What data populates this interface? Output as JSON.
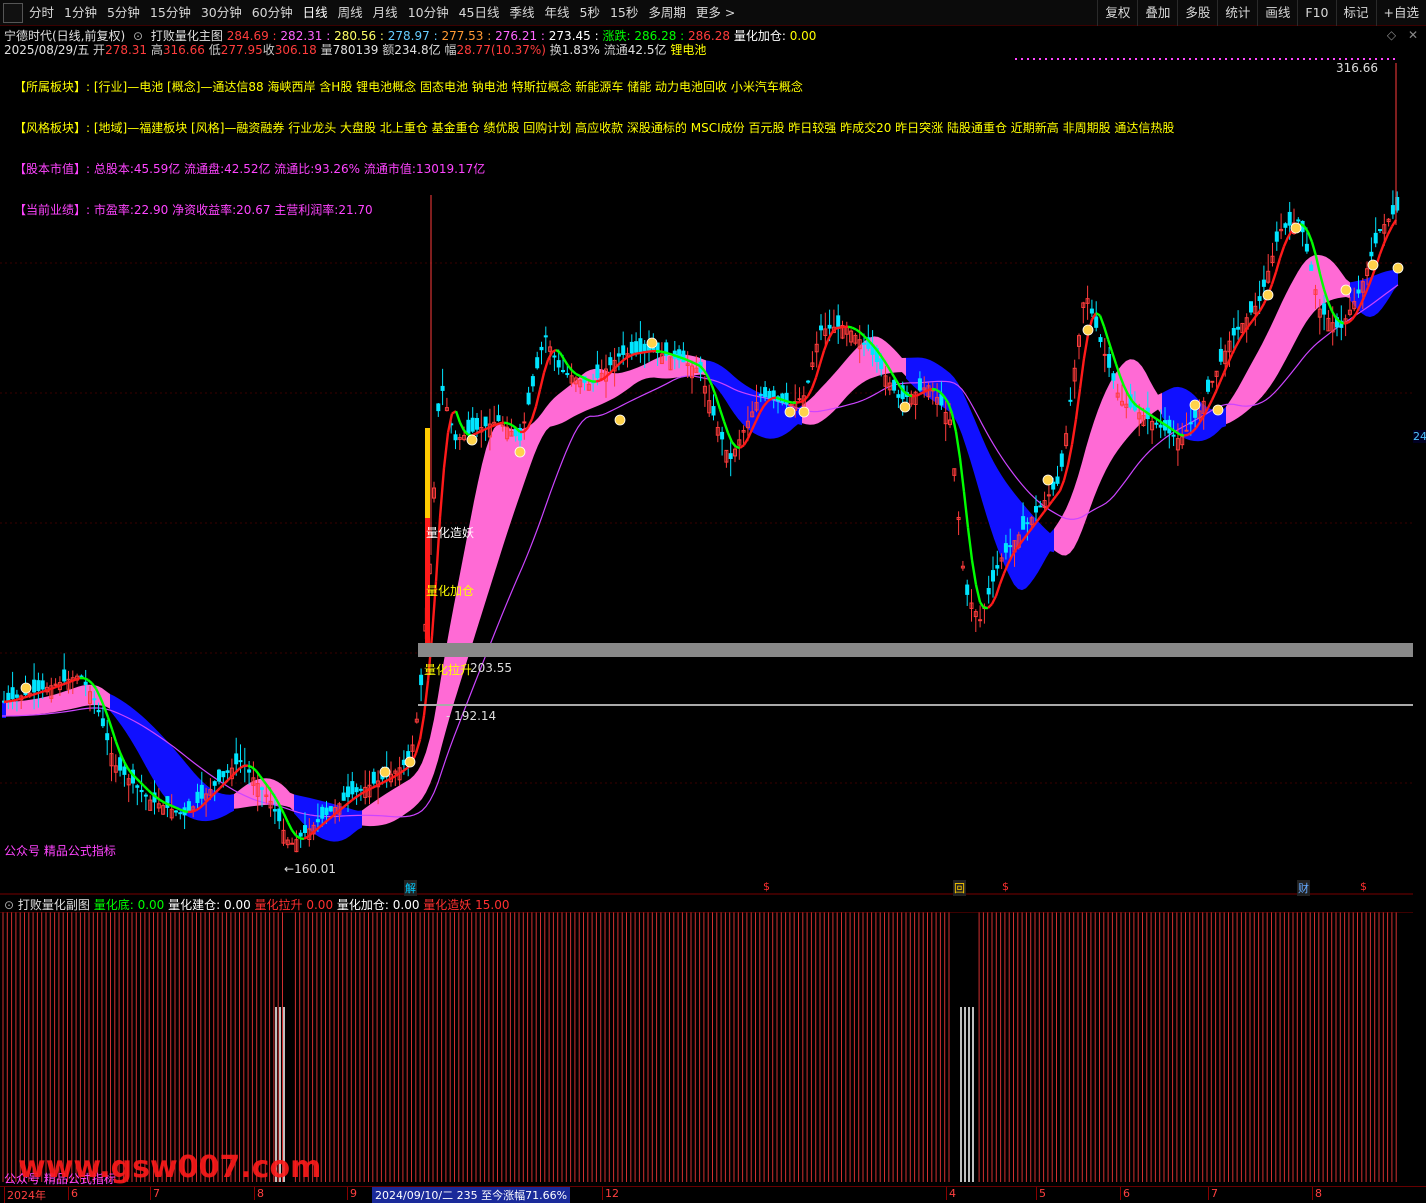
{
  "toolbar": {
    "periods": [
      "分时",
      "1分钟",
      "5分钟",
      "15分钟",
      "30分钟",
      "60分钟",
      "日线",
      "周线",
      "月线",
      "10分钟",
      "45日线",
      "季线",
      "年线",
      "5秒",
      "15秒",
      "多周期",
      "更多 >"
    ],
    "active_period": "日线",
    "right": [
      "复权",
      "叠加",
      "多股",
      "统计",
      "画线",
      "F10",
      "标记",
      "+自选"
    ]
  },
  "main": {
    "stock": "宁德时代(日线,前复权)",
    "indicator_name": "打败量化主图",
    "indicator_values": [
      "284.69",
      "282.31",
      "280.56",
      "278.97",
      "277.53",
      "276.21",
      "273.45"
    ],
    "rise_label": "涨跌:",
    "rise_values": [
      "286.28",
      "286.28"
    ],
    "add_label": "量化加仓:",
    "add_value": "0.00",
    "quote": {
      "date": "2025/08/29/五",
      "open_l": "开",
      "open": "278.31",
      "high_l": "高",
      "high": "316.66",
      "low_l": "低",
      "low": "277.95",
      "close_l": "收",
      "close": "306.18",
      "vol_l": "量",
      "vol": "780139",
      "amt_l": "额",
      "amt": "234.8亿",
      "chg_l": "幅",
      "chg": "28.77(10.37%)",
      "turn_l": "换",
      "turn": "1.83%",
      "float_l": "流通",
      "float": "42.5亿",
      "sector": "锂电池"
    },
    "info": [
      {
        "label": "【所属板块】:",
        "text": "[行业]—电池 [概念]—通达信88 海峡西岸 含H股 锂电池概念 固态电池 钠电池 特斯拉概念 新能源车 储能 动力电池回收 小米汽车概念",
        "color": "#ffff00",
        "text_color": "#ffff00"
      },
      {
        "label": "【风格板块】:",
        "text": "[地域]—福建板块 [风格]—融资融券 行业龙头 大盘股 北上重仓 基金重仓 绩优股 回购计划 高应收款 深股通标的 MSCI成份 百元股 昨日较强 昨成交20 昨日突涨 陆股通重仓 近期新高 非周期股 通达信热股",
        "color": "#ffff00",
        "text_color": "#ffff00"
      },
      {
        "label": "【股本市值】:",
        "text": "总股本:45.59亿 流通盘:42.52亿 流通比:93.26% 流通市值:13019.17亿",
        "color": "#ff44ff",
        "text_color": "#ff44ff"
      },
      {
        "label": "【当前业绩】:",
        "text": "市盈率:22.90 净资收益率:20.67 主营利润率:21.70",
        "color": "#ff44ff",
        "text_color": "#ff44ff"
      }
    ],
    "labels": {
      "max": "316.66",
      "min": "160.01",
      "level1": "203.55",
      "level2": "192.14",
      "level2_prefix": "-",
      "signal_zao": "量化造妖",
      "signal_jia": "量化加仓",
      "signal_la": "量化拉升",
      "watermark": "公众号 精品公式指标",
      "right_edge": "24"
    },
    "markers": [
      {
        "text": "解",
        "color": "#00ccff"
      },
      {
        "text": "$",
        "color": "#ff3030"
      },
      {
        "text": "回",
        "color": "#ffcc00"
      },
      {
        "text": "$",
        "color": "#ff3030"
      },
      {
        "text": "财",
        "color": "#66aaff"
      },
      {
        "text": "$",
        "color": "#ff3030"
      }
    ]
  },
  "sub": {
    "name": "打败量化副图",
    "items": [
      {
        "label": "量化底:",
        "value": "0.00",
        "color": "#00ff00"
      },
      {
        "label": "量化建仓:",
        "value": "0.00",
        "color": "#ffffff"
      },
      {
        "label": "量化拉升",
        "value": "0.00",
        "color": "#ff3030"
      },
      {
        "label": "量化加仓:",
        "value": "0.00",
        "color": "#ffffff"
      },
      {
        "label": "量化造妖",
        "value": "15.00",
        "color": "#ff3030"
      }
    ],
    "watermark": "公众号 精品公式指标",
    "site": "www.gsw007.com"
  },
  "axis": {
    "months": [
      "2024年",
      "6",
      "7",
      "8",
      "9",
      "12",
      "4",
      "5",
      "6",
      "7",
      "8"
    ],
    "highlight": "2024/09/10/二 235 至今涨幅71.66%"
  },
  "colors": {
    "up": "#ff3c3c",
    "down": "#00e5ff",
    "ribbon_up": "#ff6ad5",
    "ribbon_down": "#1010ff",
    "fast": "#00ff00",
    "slow": "#ff1a1a"
  }
}
